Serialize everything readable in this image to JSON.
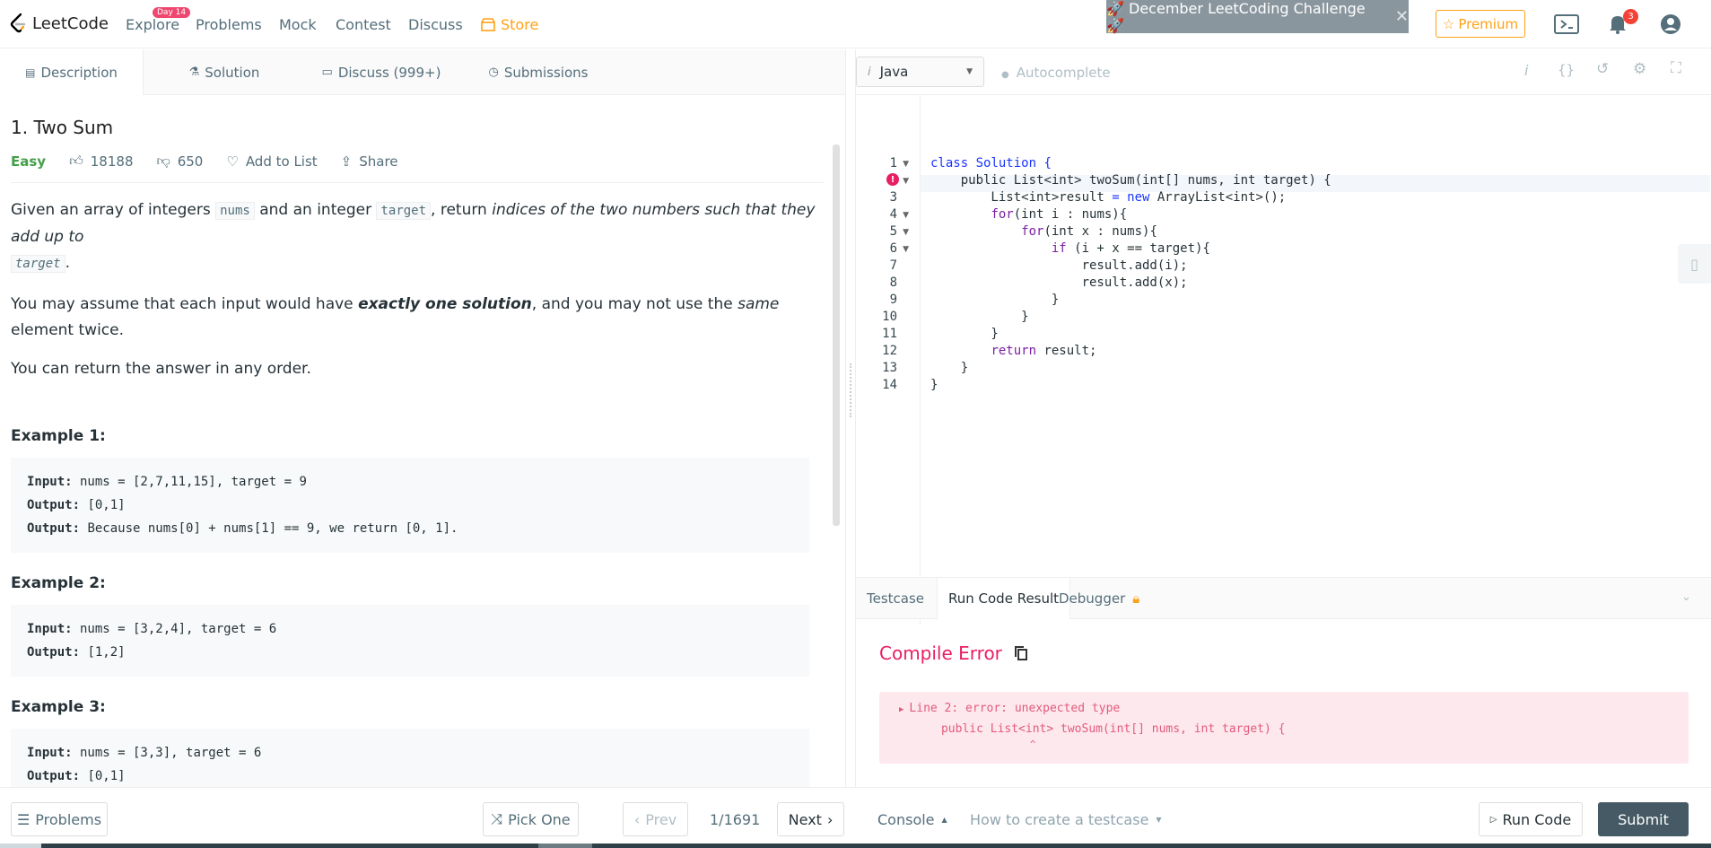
{
  "nav": {
    "brand": "LeetCode",
    "explore": "Explore",
    "explore_badge": "Day 14",
    "problems": "Problems",
    "mock": "Mock",
    "contest": "Contest",
    "discuss": "Discuss",
    "store": "Store",
    "banner": "🚀 December LeetCoding Challenge 🚀",
    "premium": "Premium",
    "notification_count": "3"
  },
  "left_tabs": {
    "description": "Description",
    "solution": "Solution",
    "discuss": "Discuss (999+)",
    "submissions": "Submissions"
  },
  "problem": {
    "title": "1. Two Sum",
    "difficulty": "Easy",
    "likes": "18188",
    "dislikes": "650",
    "add_to_list": "Add to List",
    "share": "Share",
    "p1_a": "Given an array of integers ",
    "p1_code1": "nums",
    "p1_b": " and an integer ",
    "p1_code2": "target",
    "p1_c": ", return ",
    "p1_em": "indices of the two numbers such that they add up to",
    "p1_code3": "target",
    "p1_d": ".",
    "p2_a": "You may assume that each input would have ",
    "p2_strong": "exactly one solution",
    "p2_b": ", and you may not use the ",
    "p2_em": "same",
    "p2_c": " element twice.",
    "p3": "You can return the answer in any order.",
    "examples": [
      {
        "heading": "Example 1:",
        "input_label": "Input:",
        "input": " nums = [2,7,11,15], target = 9",
        "output_label": "Output:",
        "output": " [0,1]",
        "expl_label": "Output:",
        "expl": " Because nums[0] + nums[1] == 9, we return [0, 1]."
      },
      {
        "heading": "Example 2:",
        "input_label": "Input:",
        "input": " nums = [3,2,4], target = 6",
        "output_label": "Output:",
        "output": " [1,2]"
      },
      {
        "heading": "Example 3:",
        "input_label": "Input:",
        "input": " nums = [3,3], target = 6",
        "output_label": "Output:",
        "output": " [0,1]"
      }
    ]
  },
  "editor": {
    "language": "Java",
    "autocomplete": "Autocomplete",
    "line_numbers": [
      "1",
      "2",
      "3",
      "4",
      "5",
      "6",
      "7",
      "8",
      "9",
      "10",
      "11",
      "12",
      "13",
      "14"
    ],
    "lines": {
      "l1_kw": "class",
      "l1_rest": " Solution {",
      "l2_indent": "    ",
      "l2_kw": "public",
      "l2_rest": " List<int> twoSum(int[] nums, int target) {",
      "l3_a": "        List<int>result ",
      "l3_eq": "= ",
      "l3_kw": "new",
      "l3_rest": " ArrayList<int>();",
      "l4_indent": "        ",
      "l4_kw": "for",
      "l4_rest": "(int i : nums){",
      "l5_indent": "            ",
      "l5_kw": "for",
      "l5_rest": "(int x : nums){",
      "l6_indent": "                ",
      "l6_kw": "if",
      "l6_rest": " (i + x == target){",
      "l7": "                    result.add(i);",
      "l8": "                    result.add(x);",
      "l9": "                }",
      "l10": "            }",
      "l11": "        }",
      "l12_indent": "        ",
      "l12_kw": "return",
      "l12_rest": " result;",
      "l13": "    }",
      "l14": "}"
    }
  },
  "results": {
    "testcase": "Testcase",
    "run_code_result": "Run Code Result",
    "debugger": "Debugger",
    "compile_error": "Compile Error",
    "error_line1": "Line 2: error: unexpected type",
    "error_line2": "      public List<int> twoSum(int[] nums, int target) {",
    "error_line3": "                      ^"
  },
  "bottom": {
    "problems": "Problems",
    "pick_one": "Pick One",
    "prev": "Prev",
    "page": "1/1691",
    "next": "Next",
    "console": "Console",
    "how_to": "How to create a testcase",
    "run_code": "Run Code",
    "submit": "Submit"
  }
}
